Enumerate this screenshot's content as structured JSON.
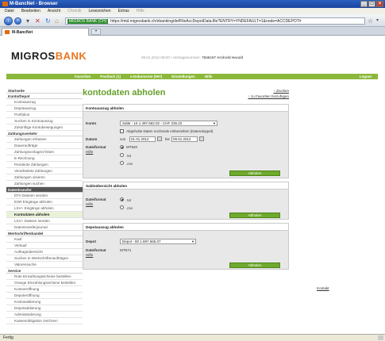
{
  "browser": {
    "title": "M-BancNet - Browser",
    "menu": [
      "Datei",
      "Bearbeiten",
      "Ansicht",
      "Chronik",
      "Lesezeichen",
      "Extras",
      "Hilfe"
    ],
    "secure_label": "MIGROS BANK (CH)",
    "url": "https://mid.migrosbank.ch/ebanking/defFileAccDepotData.file?ENTRY=YNDEFAULT=1&node=ACCDEPOT#",
    "tab_label": "M-BancNet",
    "tab_new": "+",
    "status": "Fertig"
  },
  "header": {
    "logo_main": "MIGROS",
    "logo_bank": "BANK",
    "session_text": "09.01.2012 09:00 / Vertragsnummer:",
    "session_user": "7846197 Arnhold Harald"
  },
  "nav": {
    "items": [
      "Favoriten",
      "Postfach (1)",
      "e-Dokumente (997)",
      "Einstellungen",
      "Hilfe"
    ],
    "logout": "Logout"
  },
  "sidebar": [
    {
      "type": "sec",
      "label": "Startseite"
    },
    {
      "type": "sec",
      "label": "Konto/Depot"
    },
    {
      "type": "item",
      "label": "Kontoauszug"
    },
    {
      "type": "item",
      "label": "Depotauszug"
    },
    {
      "type": "item",
      "label": "Portfolios"
    },
    {
      "type": "item",
      "label": "Suchen in Kontoauszug"
    },
    {
      "type": "item",
      "label": "Zukünftige Kontobewegungen"
    },
    {
      "type": "sec",
      "label": "Zahlungsverkehr"
    },
    {
      "type": "item",
      "label": "Zahlungen erfassen"
    },
    {
      "type": "item",
      "label": "Daueraufträge"
    },
    {
      "type": "item",
      "label": "Zahlungsvorlagen/-listen"
    },
    {
      "type": "item",
      "label": "E-Rechnung"
    },
    {
      "type": "item",
      "label": "Pendente Zahlungen"
    },
    {
      "type": "item",
      "label": "Verarbeitete Zahlungen"
    },
    {
      "type": "item",
      "label": "Zahlungen visieren"
    },
    {
      "type": "item",
      "label": "Zahlungen suchen"
    },
    {
      "type": "secdark",
      "label": "Datentransfer"
    },
    {
      "type": "item",
      "label": "DTA Dateien senden"
    },
    {
      "type": "item",
      "label": "ESR Eingänge abholen"
    },
    {
      "type": "item",
      "label": "LSV+ Eingänge abholen"
    },
    {
      "type": "active",
      "label": "Kontodaten abholen"
    },
    {
      "type": "item",
      "label": "LSV+ Dateien senden"
    },
    {
      "type": "item",
      "label": "Datentransferjournal"
    },
    {
      "type": "sec",
      "label": "Wertschriftenhandel"
    },
    {
      "type": "item",
      "label": "Kauf"
    },
    {
      "type": "item",
      "label": "Verkauf"
    },
    {
      "type": "item",
      "label": "Auftragsübersicht"
    },
    {
      "type": "item2",
      "label": "Suchen in Wertschriftenaufträgen"
    },
    {
      "type": "item",
      "label": "Valorensuche"
    },
    {
      "type": "sec",
      "label": "Service"
    },
    {
      "type": "item2",
      "label": "Rote Einzahlungsscheine bestellen"
    },
    {
      "type": "item2",
      "label": "Orange Einzahlungsscheine bestellen"
    },
    {
      "type": "item",
      "label": "Kontoeröffnung"
    },
    {
      "type": "item",
      "label": "Depoteröffnung"
    },
    {
      "type": "item",
      "label": "Kontosaldierung"
    },
    {
      "type": "item",
      "label": "Depotsaldierung"
    },
    {
      "type": "item",
      "label": "Adressänderung"
    },
    {
      "type": "item",
      "label": "Kassenobligation zeichnen"
    }
  ],
  "main": {
    "title": "kontodaten abholen",
    "print_link": "drucken",
    "favorite_link": "zu Favoriten hinzufügen",
    "konto": {
      "header": "Kontoauszug abholen",
      "konto_label": "Konto",
      "konto_value": "Salär - 16 1.497.662.02 - CHF 236.22",
      "checkbox_label": "Abgeholte Daten nochmals einbeziehen (Datendoppel)",
      "datum_label": "Datum",
      "von_label": "von",
      "von_value": "01.01.2012",
      "bis_label": "bis",
      "bis_value": "09.01.2012",
      "format_label": "Dateiformat",
      "help": "Hilfe",
      "options": [
        "MT940",
        ".txt",
        ".csv"
      ],
      "button": "Abholen"
    },
    "saldo": {
      "header": "Saldoübersicht abholen",
      "format_label": "Dateiformat",
      "help": "Hilfe",
      "options": [
        ".txt",
        ".csv"
      ],
      "button": "Abholen"
    },
    "depot": {
      "header": "Depotauszug abholen",
      "depot_label": "Depot",
      "depot_value": "Depot - 80 1.697.665.07",
      "format_label": "Dateiformat",
      "help": "Hilfe",
      "format_value": "MT571",
      "button": "Abholen"
    },
    "kontakt": "Kontakt"
  }
}
